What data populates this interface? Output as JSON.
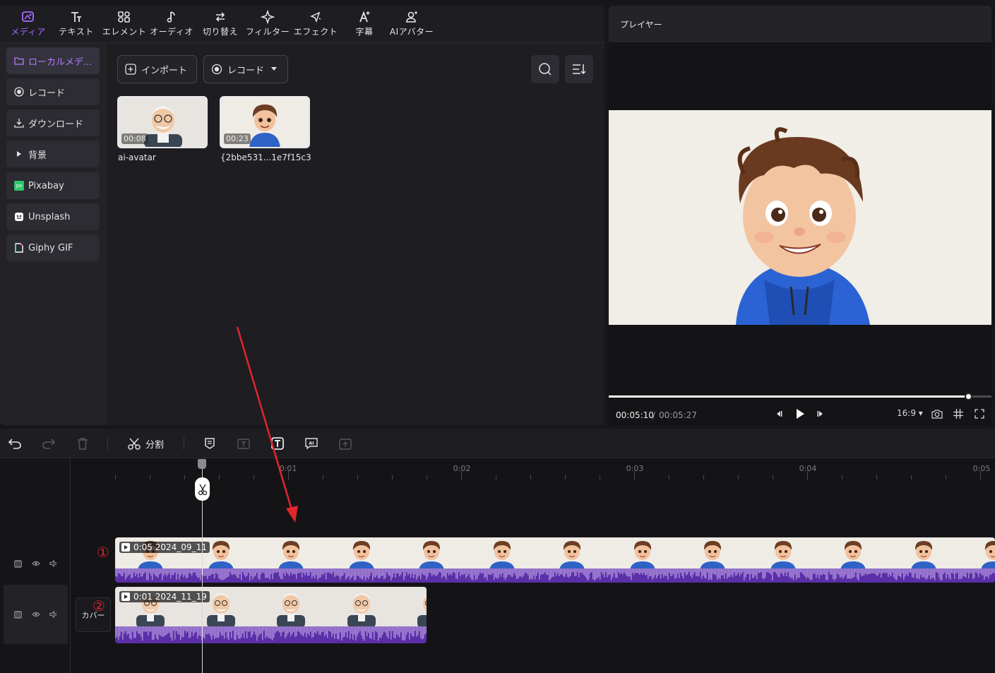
{
  "toolbar": {
    "tabs": [
      {
        "label": "メディア",
        "icon": "media-icon",
        "active": true
      },
      {
        "label": "テキスト",
        "icon": "text-icon"
      },
      {
        "label": "エレメント",
        "icon": "element-icon"
      },
      {
        "label": "オーディオ",
        "icon": "audio-icon"
      },
      {
        "label": "切り替え",
        "icon": "transition-icon"
      },
      {
        "label": "フィルター",
        "icon": "filter-icon"
      },
      {
        "label": "エフェクト",
        "icon": "effect-icon"
      },
      {
        "label": "字幕",
        "icon": "subtitle-icon"
      },
      {
        "label": "AIアバター",
        "icon": "ai-avatar-icon"
      }
    ]
  },
  "sidebar": {
    "items": [
      {
        "label": "ローカルメデ...",
        "icon": "folder-icon",
        "active": true
      },
      {
        "label": "レコード",
        "icon": "record-icon"
      },
      {
        "label": "ダウンロード",
        "icon": "download-icon"
      },
      {
        "label": "背景",
        "icon": "caret-right-icon"
      },
      {
        "label": "Pixabay",
        "icon": "pixabay-icon"
      },
      {
        "label": "Unsplash",
        "icon": "unsplash-icon"
      },
      {
        "label": "Giphy GIF",
        "icon": "giphy-icon"
      }
    ]
  },
  "media": {
    "import_label": "インポート",
    "record_label": "レコード",
    "items": [
      {
        "name": "ai-avatar",
        "duration": "00:08"
      },
      {
        "name": "{2bbe531...1e7f15c3",
        "duration": "00:23"
      }
    ]
  },
  "player": {
    "title": "プレイヤー",
    "current_time": "00:05:10",
    "separator": "/",
    "total_time": "00:05:27",
    "progress": 0.94,
    "aspect_ratio": "16:9 ▾"
  },
  "timeline": {
    "split_label": "分割",
    "ruler_labels": [
      "0:01",
      "0:02",
      "0:03",
      "0:04",
      "0:05"
    ],
    "cover_label": "カバー",
    "clips": [
      {
        "label": "0:05 2024_09_11",
        "marker": "①"
      },
      {
        "label": "0:01 2024_11_19",
        "marker": "②"
      }
    ]
  },
  "colors": {
    "accent": "#a86bff",
    "audio_wave": "#5b2fa8",
    "annotation": "#e0262c"
  }
}
